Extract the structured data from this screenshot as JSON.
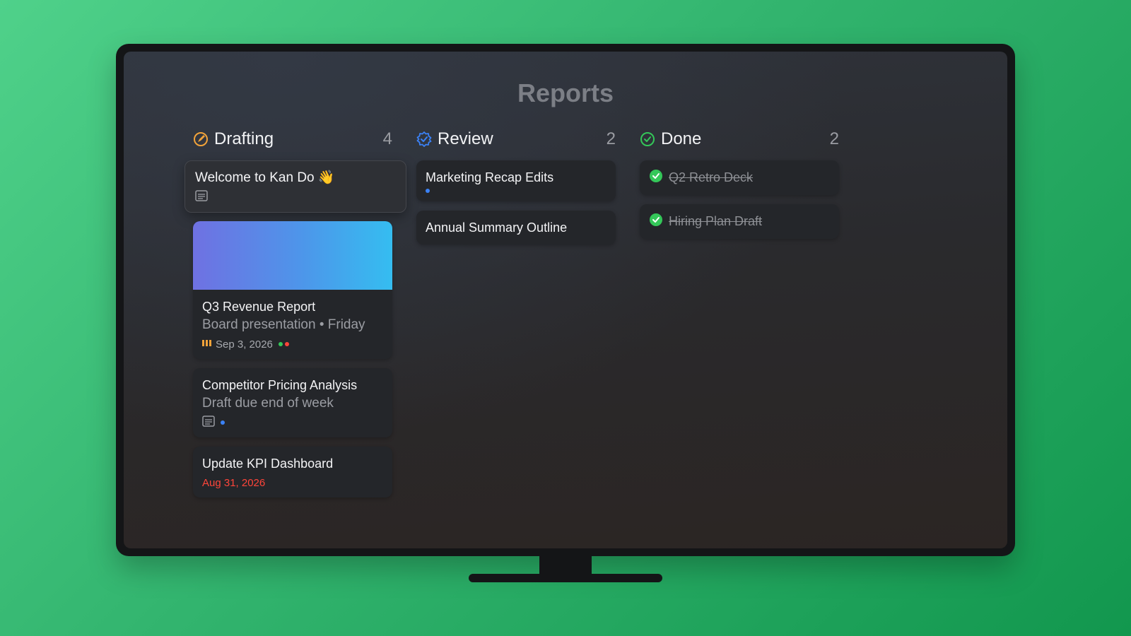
{
  "board": {
    "title": "Reports"
  },
  "colors": {
    "drafting": "#f2a33a",
    "review": "#3b82f6",
    "done": "#34c759",
    "overdue": "#ff453a"
  },
  "columns": {
    "drafting": {
      "name": "Drafting",
      "count": "4",
      "welcome": {
        "title": "Welcome to Kan Do 👋",
        "icon": "notes-icon"
      },
      "cards": [
        {
          "title": "Q3 Revenue Report",
          "subtitle": "Board presentation • Friday",
          "date": "Sep 3, 2026",
          "priority_icon": "priority-bars-icon",
          "tags": [
            "green",
            "red"
          ]
        },
        {
          "title": "Competitor Pricing Analysis",
          "subtitle": "Draft due end of week",
          "icon": "notes-icon",
          "tags": [
            "blue"
          ]
        },
        {
          "title": "Update KPI Dashboard",
          "date": "Aug 31, 2026"
        }
      ]
    },
    "review": {
      "name": "Review",
      "count": "2",
      "cards": [
        {
          "title": "Marketing Recap Edits",
          "tags": [
            "blue"
          ]
        },
        {
          "title": "Annual Summary Outline"
        }
      ]
    },
    "done": {
      "name": "Done",
      "count": "2",
      "cards": [
        {
          "title": "Q2 Retro Deck"
        },
        {
          "title": "Hiring Plan Draft"
        }
      ]
    }
  }
}
